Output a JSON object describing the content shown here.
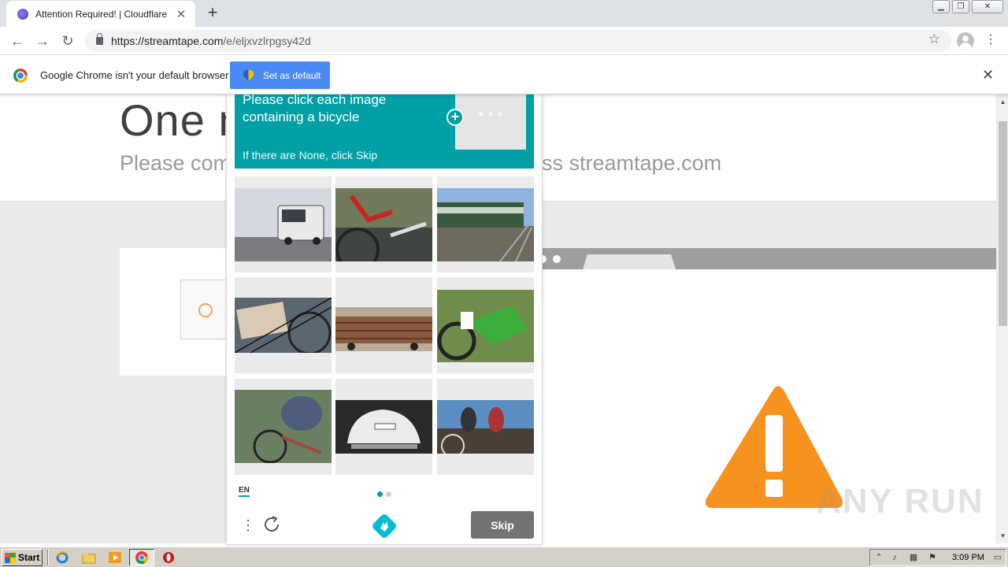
{
  "tab": {
    "title": "Attention Required! | Cloudflare",
    "close": "✕"
  },
  "newtab": "+",
  "window": {
    "minimize": "▁",
    "restore": "❐",
    "close": "✕"
  },
  "toolbar": {
    "back": "←",
    "forward": "→",
    "reload": "↻",
    "url_host": "https://streamtape.com",
    "url_path": "/e/eljxvzlrpgsy42d",
    "star": "☆",
    "menu": "⋮"
  },
  "infobar": {
    "message": "Google Chrome isn't your default browser",
    "button": "Set as default",
    "close": "✕"
  },
  "cloudflare": {
    "title_visible": "One m",
    "subtitle_left": "Please com",
    "subtitle_right": "ss streamtape.com"
  },
  "captcha": {
    "prompt": "Please click each image containing a bicycle",
    "hint": "If there are None, click Skip",
    "plus": "+",
    "language": "EN",
    "menu": "⋮",
    "skip": "Skip",
    "colors": {
      "accent": "#00a0a6",
      "skip": "#737373"
    },
    "images": [
      {
        "subject": "bus"
      },
      {
        "subject": "bicycle"
      },
      {
        "subject": "train"
      },
      {
        "subject": "bicycle"
      },
      {
        "subject": "truck"
      },
      {
        "subject": "motorcycle"
      },
      {
        "subject": "bicycle"
      },
      {
        "subject": "car"
      },
      {
        "subject": "bicycle"
      }
    ]
  },
  "scrollbar": {
    "up": "▲",
    "down": "▼"
  },
  "watermark": "ANY RUN",
  "taskbar": {
    "start": "Start",
    "clock": "3:09 PM"
  }
}
